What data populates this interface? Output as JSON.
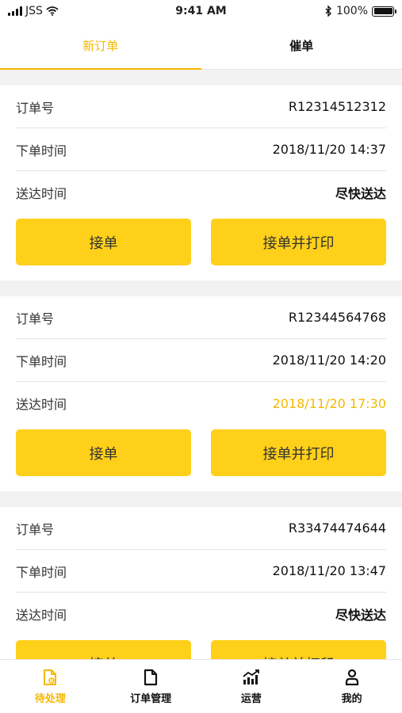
{
  "status_bar": {
    "carrier": "JSS",
    "time": "9:41 AM",
    "battery": "100%",
    "battery_level": 1.0
  },
  "top_tabs": [
    {
      "label": "新订单",
      "active": true
    },
    {
      "label": "催单",
      "active": false
    }
  ],
  "orders": [
    {
      "order_no_label": "订单号",
      "order_no": "R12314512312",
      "placed_label": "下单时间",
      "placed_time": "2018/11/20 14:37",
      "deliver_label": "送达时间",
      "deliver_time": "尽快送达",
      "accept_label": "接单",
      "accept_print_label": "接单并打印"
    },
    {
      "order_no_label": "订单号",
      "order_no": "R12344564768",
      "placed_label": "下单时间",
      "placed_time": "2018/11/20 14:20",
      "deliver_label": "送达时间",
      "deliver_time": "2018/11/20 17:30",
      "accept_label": "接单",
      "accept_print_label": "接单并打印"
    },
    {
      "order_no_label": "订单号",
      "order_no": "R33474474644",
      "placed_label": "下单时间",
      "placed_time": "2018/11/20 13:47",
      "deliver_label": "送达时间",
      "deliver_time": "尽快送达",
      "accept_label": "接单",
      "accept_print_label": "接单并打印"
    }
  ],
  "bottom_tabs": [
    {
      "label": "待处理",
      "icon": "pending-order-icon",
      "active": true
    },
    {
      "label": "订单管理",
      "icon": "document-icon",
      "active": false
    },
    {
      "label": "运营",
      "icon": "chart-icon",
      "active": false
    },
    {
      "label": "我的",
      "icon": "user-icon",
      "active": false
    }
  ],
  "colors": {
    "accent": "#f5b800",
    "button": "#ffd01a",
    "background": "#f2f2f2"
  }
}
